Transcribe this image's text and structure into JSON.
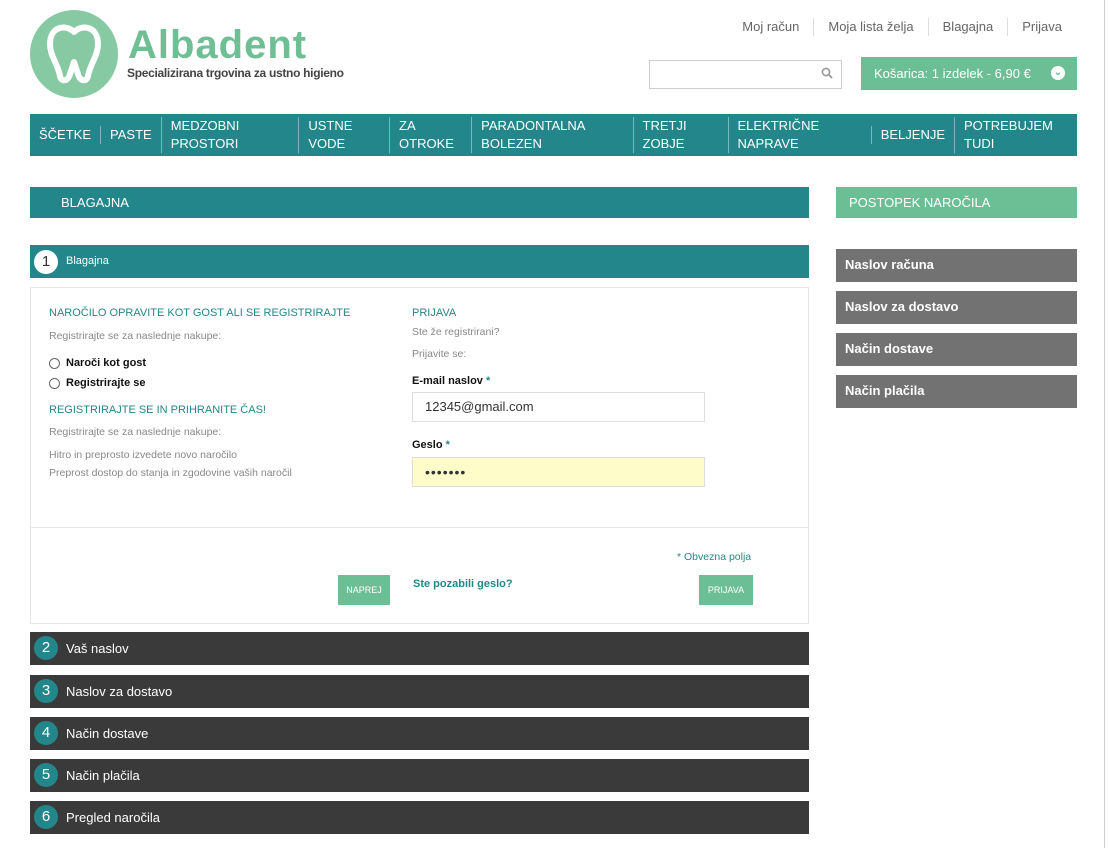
{
  "header": {
    "logo_name": "Albadent",
    "logo_tagline": "Specializirana trgovina za ustno higieno",
    "top_links": [
      "Moj račun",
      "Moja lista želja",
      "Blagajna",
      "Prijava"
    ],
    "search": {
      "value": "",
      "placeholder": ""
    },
    "cart_label": "Košarica: 1 izdelek - 6,90 €"
  },
  "nav": [
    "ŠČETKE",
    "PASTE",
    "MEDZOBNI PROSTORI",
    "USTNE VODE",
    "ZA OTROKE",
    "PARADONTALNA BOLEZEN",
    "TRETJI ZOBJE",
    "ELEKTRIČNE NAPRAVE",
    "BELJENJE",
    "POTREBUJEM TUDI"
  ],
  "main": {
    "title": "BLAGAJNA",
    "step1": {
      "number": "1",
      "label": "Blagajna"
    },
    "left": {
      "heading": "NAROČILO OPRAVITE KOT GOST ALI SE REGISTRIRAJTE",
      "subtext": "Registrirajte se za naslednje nakupe:",
      "radio_guest": "Naroči kot gost",
      "radio_register": "Registrirajte se",
      "heading2": "REGISTRIRAJTE SE IN PRIHRANITE ČAS!",
      "subtext2": "Registrirajte se za naslednje nakupe:",
      "benefit1": "Hitro in preprosto izvedete novo naročilo",
      "benefit2": "Preprost dostop do stanja in zgodovine vaših naročil",
      "continue_button": "NAPREJ"
    },
    "right": {
      "heading": "PRIJAVA",
      "already": "Ste že registrirani?",
      "login_prompt": "Prijavite se:",
      "email_label": "E-mail naslov",
      "email_value": "12345@gmail.com",
      "password_label": "Geslo",
      "password_value": "•••••••",
      "required_asterisk": "*",
      "required_note": "* Obvezna polja",
      "forgot_link": "Ste pozabili geslo?",
      "login_button": "PRIJAVA"
    },
    "steps": [
      {
        "number": "2",
        "label": "Vaš naslov"
      },
      {
        "number": "3",
        "label": "Naslov za dostavo"
      },
      {
        "number": "4",
        "label": "Način dostave"
      },
      {
        "number": "5",
        "label": "Način plačila"
      },
      {
        "number": "6",
        "label": "Pregled naročila"
      }
    ]
  },
  "sidebar": {
    "title": "POSTOPEK NAROČILA",
    "items": [
      "Naslov računa",
      "Naslov za dostavo",
      "Način dostave",
      "Način plačila"
    ]
  },
  "colors": {
    "teal": "#23868b",
    "green": "#6cbf95",
    "dark": "#3a3a3a",
    "gray": "#727272",
    "password_bg": "#fefcc8"
  }
}
